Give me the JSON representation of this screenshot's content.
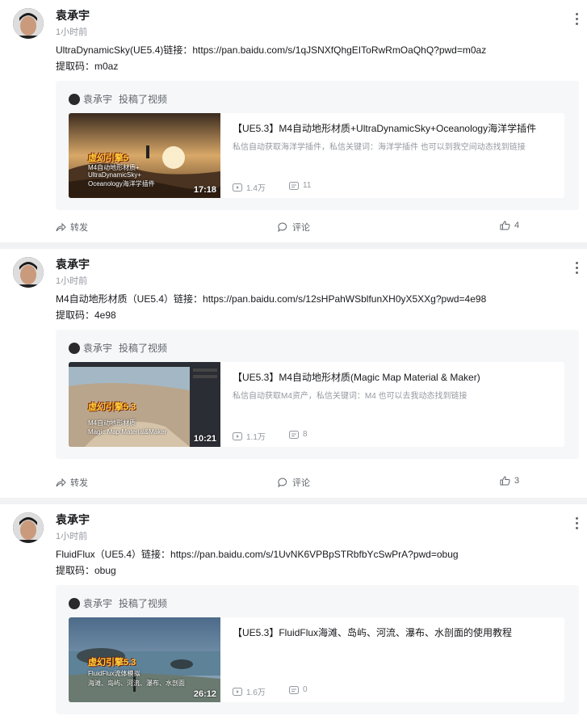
{
  "posts": [
    {
      "author": "袁承宇",
      "time": "1小时前",
      "text": "UltraDynamicSky(UE5.4)链接：https://pan.baidu.com/s/1qJSNXfQhgEIToRwRmOaQhQ?pwd=m0az",
      "code": "提取码：m0az",
      "repost": {
        "author": "袁承宇",
        "action": "投稿了视频",
        "video": {
          "title": "【UE5.3】M4自动地形材质+UltraDynamicSky+Oceanology海洋学插件",
          "desc": "私信自动获取海洋学插件，私信关键词：海洋学插件 也可以到我空间动态找到链接",
          "duration": "17:18",
          "views": "1.4万",
          "danmaku": "11",
          "thumb_brand": "虚幻引擎5",
          "thumb_lines": [
            "M4自动地形材质+",
            "UltraDynamicSky+",
            "Oceanology海洋学插件"
          ]
        }
      },
      "actions": {
        "forward": "转发",
        "comment": "评论",
        "like": "4"
      }
    },
    {
      "author": "袁承宇",
      "time": "1小时前",
      "text": "M4自动地形材质（UE5.4）链接：https://pan.baidu.com/s/12sHPahWSblfunXH0yX5XXg?pwd=4e98",
      "code": "提取码：4e98",
      "repost": {
        "author": "袁承宇",
        "action": "投稿了视频",
        "video": {
          "title": "【UE5.3】M4自动地形材质(Magic Map Material & Maker)",
          "desc": "私信自动获取M4资产，私信关键词：M4 也可以去我动态找到链接",
          "duration": "10:21",
          "views": "1.1万",
          "danmaku": "8",
          "thumb_brand": "虚幻引擎5.3",
          "thumb_lines": [
            "M4自动地形材质",
            "Magic Map Material&Maker"
          ]
        }
      },
      "actions": {
        "forward": "转发",
        "comment": "评论",
        "like": "3"
      }
    },
    {
      "author": "袁承宇",
      "time": "1小时前",
      "text": "FluidFlux（UE5.4）链接：https://pan.baidu.com/s/1UvNK6VPBpSTRbfbYcSwPrA?pwd=obug",
      "code": "提取码：obug",
      "repost": {
        "author": "袁承宇",
        "action": "投稿了视频",
        "video": {
          "title": "【UE5.3】FluidFlux海滩、岛屿、河流、瀑布、水剖面的使用教程",
          "desc": "",
          "duration": "26:12",
          "views": "1.6万",
          "danmaku": "0",
          "thumb_brand": "虚幻引擎5.3",
          "thumb_lines": [
            "FluidFlux流体模拟",
            "海滩、岛屿、河流、瀑布、水剖面"
          ]
        }
      }
    }
  ],
  "colors": {
    "text": "#18191c",
    "muted": "#9499a0",
    "icon": "#61666d",
    "repost_bg": "#f6f7f8",
    "page_bg": "#f1f2f3"
  },
  "icons": [
    "more-icon",
    "play-icon",
    "danmaku-icon",
    "forward-icon",
    "comment-icon",
    "like-icon"
  ]
}
